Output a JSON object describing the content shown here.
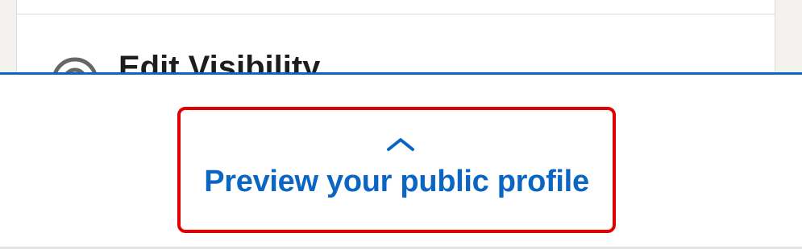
{
  "section": {
    "title": "Edit Visibility",
    "icon": "eye-icon"
  },
  "preview": {
    "label": "Preview your public profile",
    "icon": "chevron-up-icon",
    "accent_color": "#0a66c2",
    "highlight_color": "#e00000"
  }
}
